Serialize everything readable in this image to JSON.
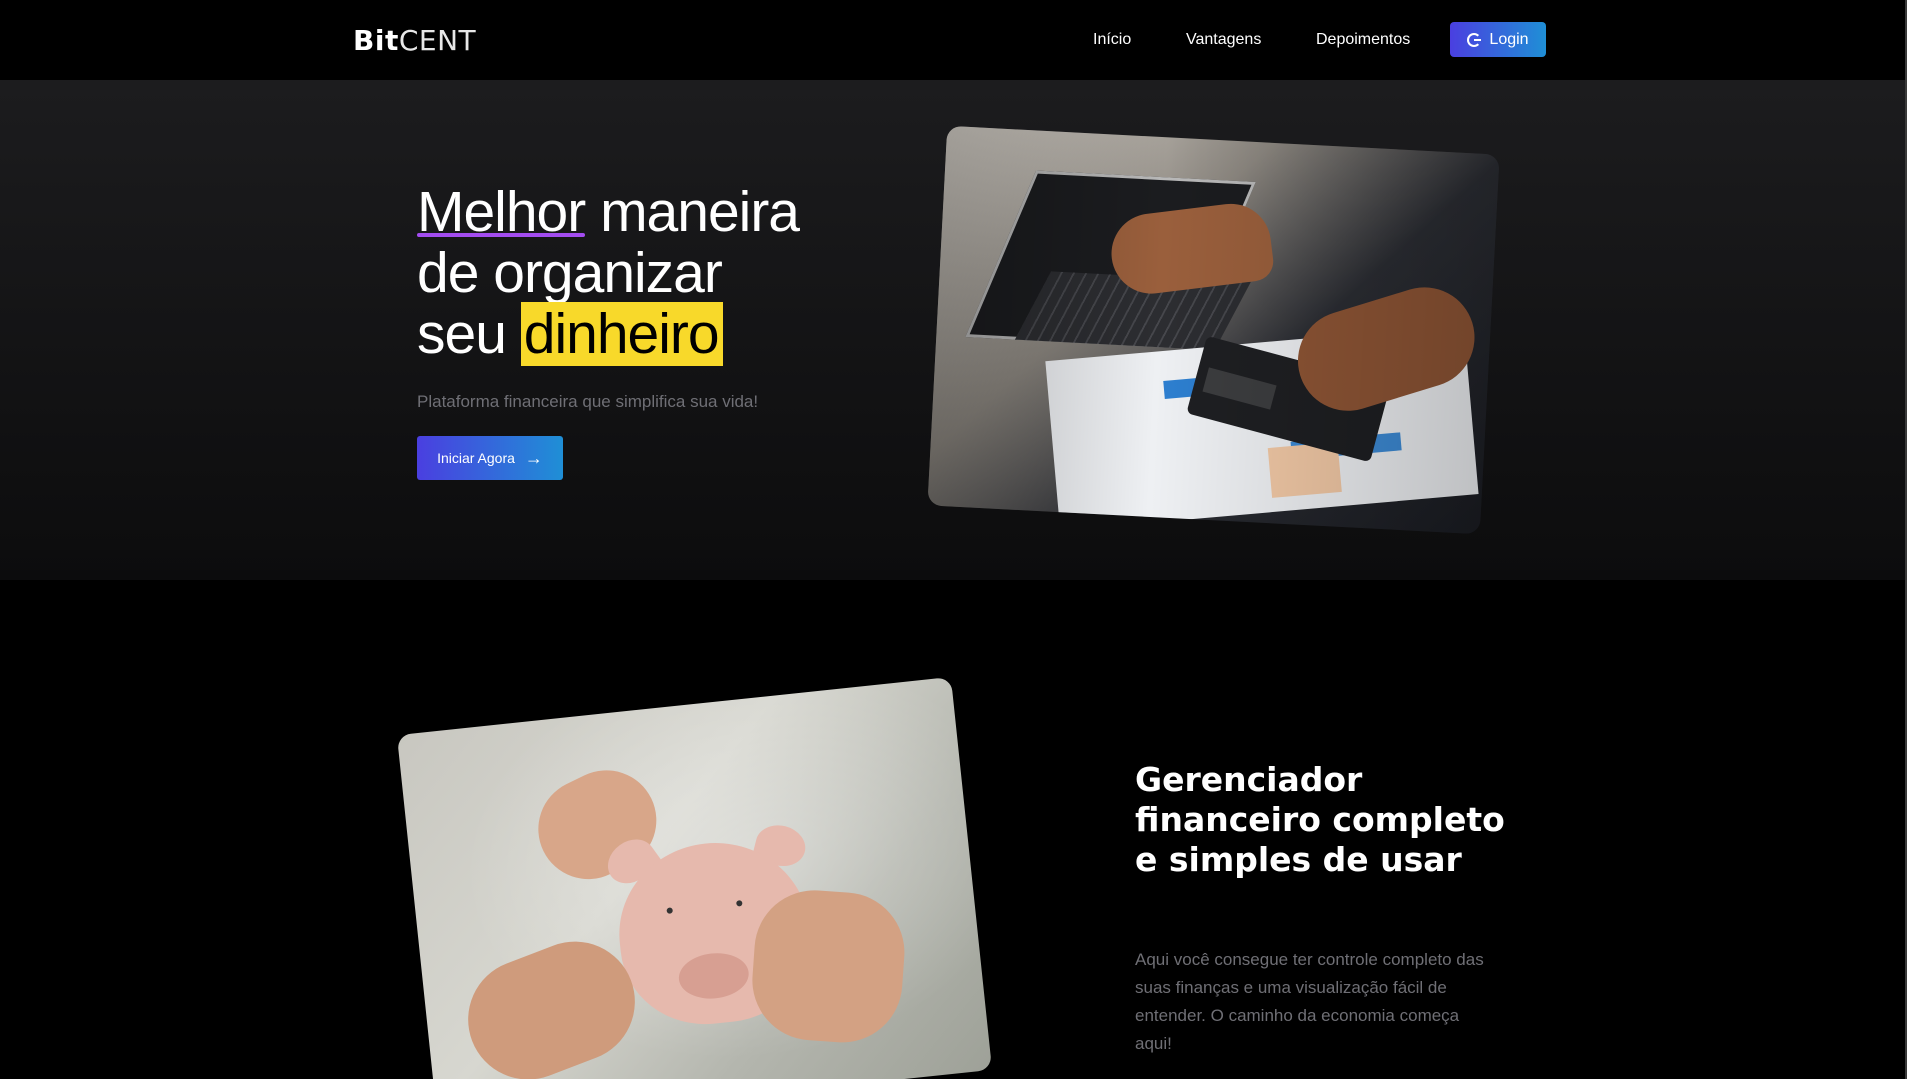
{
  "brand": {
    "bold": "Bit",
    "light": "CENT"
  },
  "nav": {
    "items": [
      {
        "label": "Início"
      },
      {
        "label": "Vantagens"
      },
      {
        "label": "Depoimentos"
      }
    ],
    "login_label": "Login",
    "login_icon": "google-icon"
  },
  "hero": {
    "headline_word1": "Melhor",
    "headline_rest1": " maneira",
    "headline_line2": "de organizar",
    "headline_line3a": "seu ",
    "headline_highlight": "dinheiro",
    "subtitle": "Plataforma financeira que simplifica sua vida!",
    "cta_label": "Iniciar Agora",
    "cta_icon": "arrow-right-icon",
    "underline_color": "#a34cf0",
    "highlight_color": "#f8d92a"
  },
  "section2": {
    "title": "Gerenciador financeiro completo e simples de usar",
    "text": "Aqui você consegue ter controle completo das suas finanças e uma visualização fácil de entender. O caminho da economia começa aqui!"
  },
  "colors": {
    "accent_gradient_start": "#4a3fe0",
    "accent_gradient_end": "#1f8fd6",
    "muted_text": "#6f6f75",
    "background": "#000000"
  }
}
